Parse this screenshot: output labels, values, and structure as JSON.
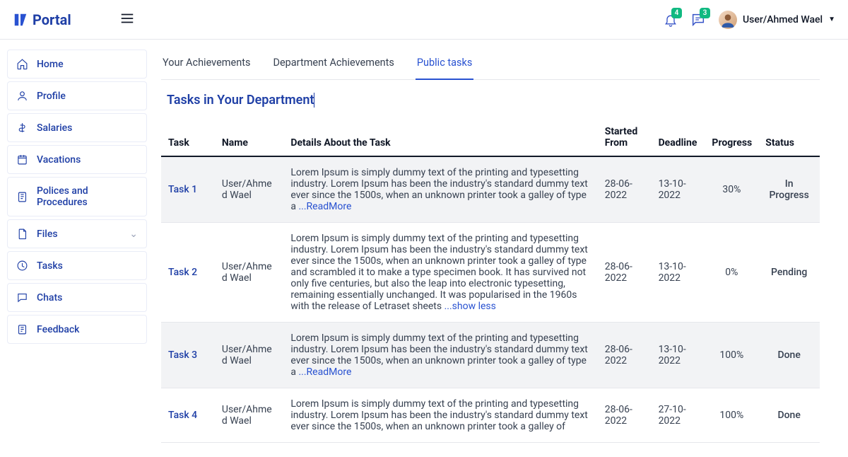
{
  "header": {
    "appName": "Portal",
    "notifCount": "4",
    "chatCount": "3",
    "userLabel": "User/Ahmed Wael"
  },
  "sidebar": {
    "items": [
      {
        "label": "Home"
      },
      {
        "label": "Profile"
      },
      {
        "label": "Salaries"
      },
      {
        "label": "Vacations"
      },
      {
        "label": "Polices and Procedures"
      },
      {
        "label": "Files",
        "hasChevron": true
      },
      {
        "label": "Tasks"
      },
      {
        "label": "Chats"
      },
      {
        "label": "Feedback"
      }
    ]
  },
  "tabs": [
    {
      "label": "Your Achievements"
    },
    {
      "label": "Department Achievements"
    },
    {
      "label": "Public tasks",
      "active": true
    }
  ],
  "pageTitle": "Tasks in Your Department",
  "columns": {
    "task": "Task",
    "name": "Name",
    "details": "Details About the Task",
    "start": "Started From",
    "deadline": "Deadline",
    "progress": "Progress",
    "status": "Status"
  },
  "readMoreLabel": "...ReadMore",
  "showLessLabel": "...show less",
  "rows": [
    {
      "task": "Task 1",
      "name": "User/Ahmed Wael",
      "details": "Lorem Ipsum is simply dummy text of the printing and typesetting industry. Lorem Ipsum has been the industry's standard dummy text ever since the 1500s, when an unknown printer took a galley of type a ",
      "toggle": "more",
      "start": "28-06-2022",
      "deadline": "13-10-2022",
      "progress": "30%",
      "status": "In Progress",
      "statusClass": "status-inprogress",
      "striped": true
    },
    {
      "task": "Task 2",
      "name": "User/Ahmed Wael",
      "details": "Lorem Ipsum is simply dummy text of the printing and typesetting industry. Lorem Ipsum has been the industry's standard dummy text ever since the 1500s, when an unknown printer took a galley of type and scrambled it to make a type specimen book. It has survived not only five centuries, but also the leap into electronic typesetting, remaining essentially unchanged. It was popularised in the 1960s with the release of Letraset sheets ",
      "toggle": "less",
      "start": "28-06-2022",
      "deadline": "13-10-2022",
      "progress": "0%",
      "status": "Pending",
      "statusClass": "status-pending",
      "striped": false
    },
    {
      "task": "Task 3",
      "name": "User/Ahmed Wael",
      "details": "Lorem Ipsum is simply dummy text of the printing and typesetting industry. Lorem Ipsum has been the industry's standard dummy text ever since the 1500s, when an unknown printer took a galley of type a ",
      "toggle": "more",
      "start": "28-06-2022",
      "deadline": "13-10-2022",
      "progress": "100%",
      "status": "Done",
      "statusClass": "status-done",
      "striped": true
    },
    {
      "task": "Task 4",
      "name": "User/Ahmed Wael",
      "details": "Lorem Ipsum is simply dummy text of the printing and typesetting industry. Lorem Ipsum has been the industry's standard dummy text ever since the 1500s, when an unknown printer took a galley of ",
      "toggle": "none",
      "start": "28-06-2022",
      "deadline": "27-10-2022",
      "progress": "100%",
      "status": "Done",
      "statusClass": "status-done",
      "striped": false
    }
  ]
}
